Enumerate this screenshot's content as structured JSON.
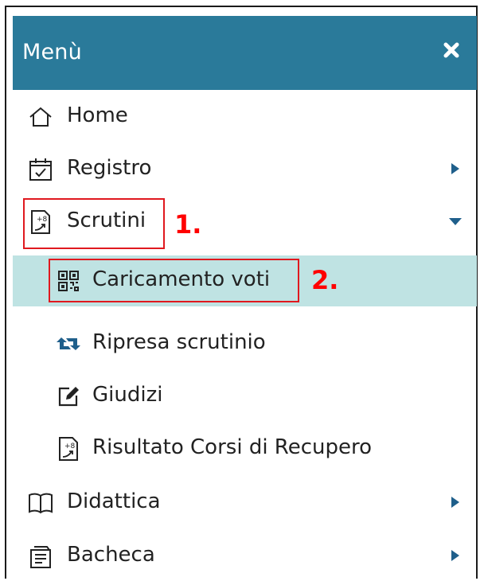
{
  "colors": {
    "accent": "#2a7a9a",
    "active": "#bfe3e3",
    "annotation": "#ff0000"
  },
  "header": {
    "title": "Menù",
    "close_icon": "close-icon"
  },
  "menu": {
    "home": {
      "label": "Home",
      "icon": "home-icon"
    },
    "registro": {
      "label": "Registro",
      "icon": "calendar-check-icon"
    },
    "scrutini": {
      "label": "Scrutini",
      "icon": "scrutini-icon",
      "expanded": true
    },
    "caricamento": {
      "label": "Caricamento voti",
      "icon": "qr-grid-icon",
      "active": true
    },
    "ripresa": {
      "label": "Ripresa scrutinio",
      "icon": "retweet-icon"
    },
    "giudizi": {
      "label": "Giudizi",
      "icon": "edit-icon"
    },
    "risultato": {
      "label": "Risultato Corsi di Recupero",
      "icon": "scrutini-icon"
    },
    "didattica": {
      "label": "Didattica",
      "icon": "book-icon"
    },
    "bacheca": {
      "label": "Bacheca",
      "icon": "board-icon"
    }
  },
  "annotations": {
    "step1": "1.",
    "step2": "2."
  }
}
